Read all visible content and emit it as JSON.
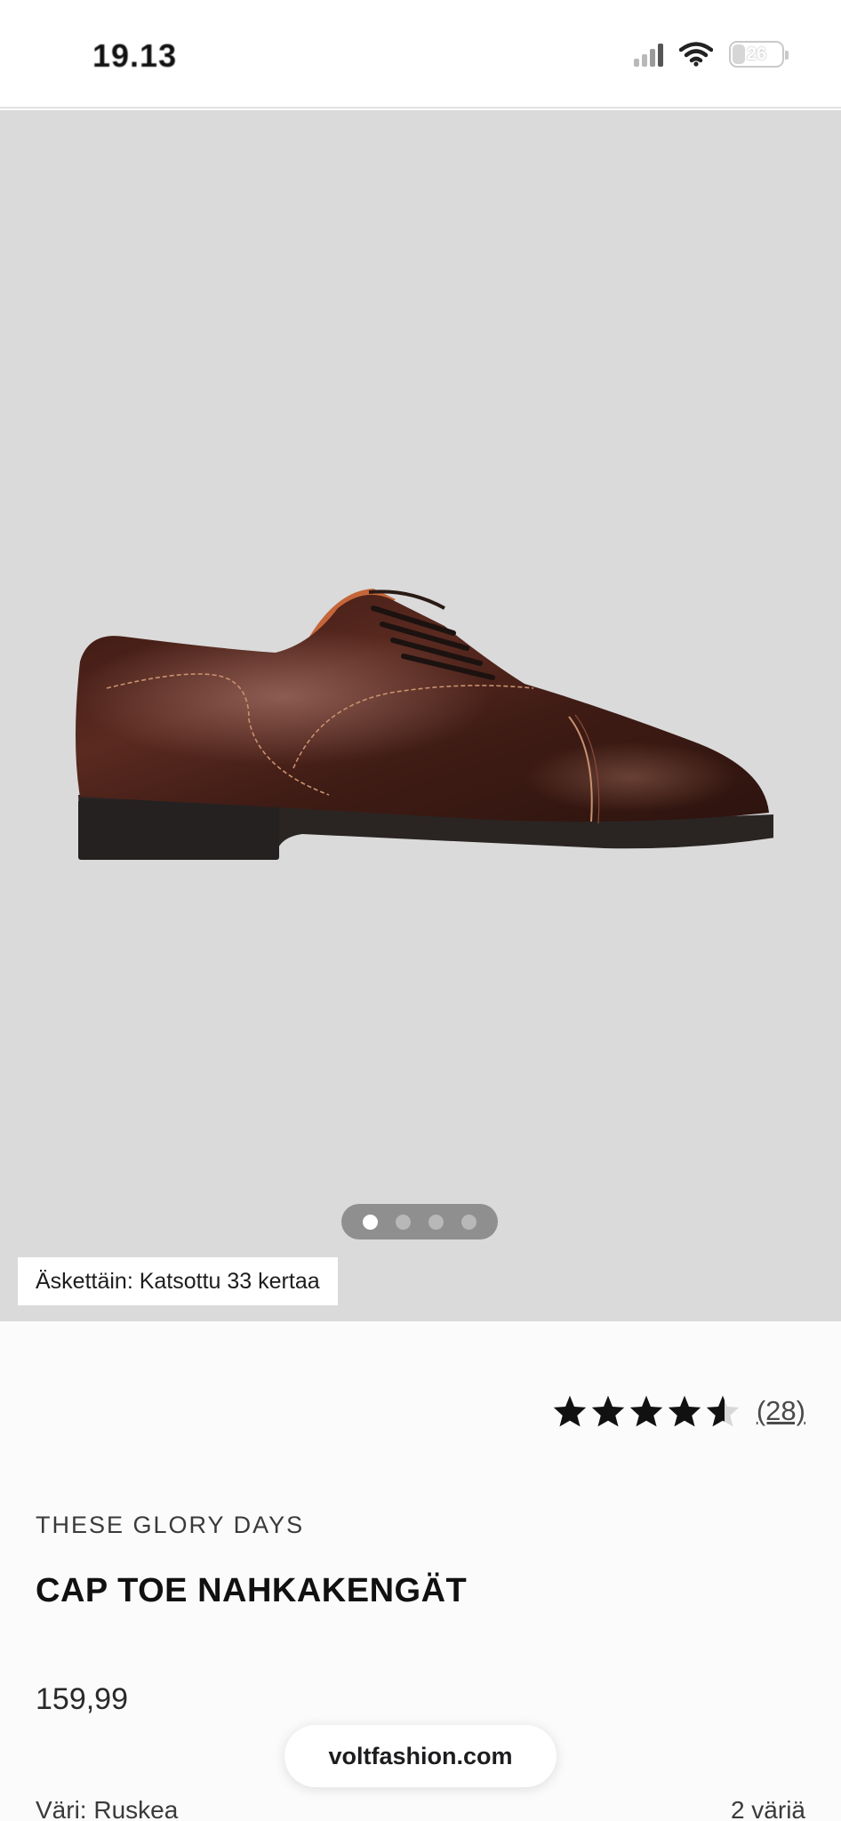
{
  "status_bar": {
    "time": "19.13",
    "battery": "26"
  },
  "gallery": {
    "image_alt": "brown leather cap toe oxford shoe",
    "dots": [
      true,
      false,
      false,
      false
    ],
    "views_badge": "Äskettäin: Katsottu 33 kertaa"
  },
  "rating": {
    "stars": 4.5,
    "count_label": "(28)"
  },
  "product": {
    "brand": "THESE GLORY DAYS",
    "title": "CAP TOE NAHKAKENGÄT",
    "price": "159,99",
    "color_label": "Väri: Ruskea",
    "color_count": "2 väriä"
  },
  "browser": {
    "url": "voltfashion.com"
  },
  "colors": {
    "gallery_bg": "#dadada",
    "shoe_leather": "#4a2219",
    "sole": "#2a2523",
    "lining": "#c4663a"
  }
}
